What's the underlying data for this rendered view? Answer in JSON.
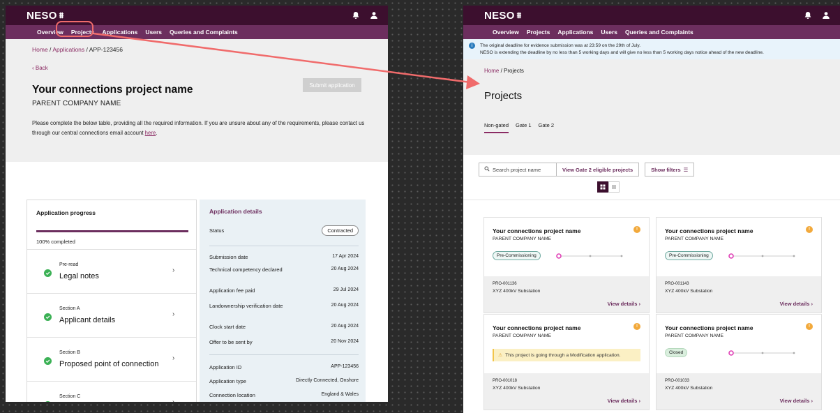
{
  "app": {
    "logo": "NESO",
    "logo_mark": "⩩"
  },
  "nav": [
    "Overview",
    "Projects",
    "Applications",
    "Users",
    "Queries and Complaints"
  ],
  "left": {
    "breadcrumb": {
      "home": "Home",
      "sep": " / ",
      "applications": "Applications",
      "sep2": " / ",
      "current": "APP-123456"
    },
    "back": "‹  Back",
    "title": "Your connections project name",
    "company": "PARENT COMPANY NAME",
    "submit_label": "Submit application",
    "intro_text": "Please complete the below table, providing all the required information. If you are unsure about any of the requirements, please contact us through our central connections email account ",
    "intro_link": "here",
    "intro_end": ".",
    "progress": {
      "title": "Application progress",
      "percent_label": "100% completed",
      "percent": 1.0,
      "sections": [
        {
          "small": "Pre-read",
          "big": "Legal notes"
        },
        {
          "small": "Section A",
          "big": "Applicant details"
        },
        {
          "small": "Section B",
          "big": "Proposed point of connection"
        },
        {
          "small": "Section C",
          "big": ""
        }
      ]
    },
    "details": {
      "title": "Application details",
      "status_label": "Status",
      "status_value": "Contracted",
      "rows": [
        {
          "k": "Submission date",
          "v": "17 Apr 2024"
        },
        {
          "k": "Technical competency declared",
          "v": "20 Aug 2024"
        },
        {
          "k": "Application fee paid",
          "v": "29 Jul 2024"
        },
        {
          "k": "Landownership verification date",
          "v": "20 Aug 2024"
        },
        {
          "k": "Clock start date",
          "v": "20 Aug 2024"
        },
        {
          "k": "Offer to be sent by",
          "v": "20 Nov 2024"
        },
        {
          "k": "Application ID",
          "v": "APP-123456"
        },
        {
          "k": "Application type",
          "v": "Directly Connected, Onshore"
        },
        {
          "k": "Connection location",
          "v": "England & Wales"
        }
      ]
    }
  },
  "right": {
    "banner_line1": "The original deadline for evidence submission was at 23:59 on the 29th of July.",
    "banner_line2": "NESO is extending the deadline by no less than 5 working days and will give no less than 5 working days notice ahead of the new deadline.",
    "breadcrumb": {
      "home": "Home",
      "sep": " / ",
      "current": "Projects"
    },
    "title": "Projects",
    "tabs": [
      "Non-gated",
      "Gate 1",
      "Gate 2"
    ],
    "search_placeholder": "Search project name",
    "gate2_btn": "View Gate 2 eligible projects",
    "filters_btn": "Show filters",
    "cards": [
      {
        "title": "Your connections project name",
        "company": "PARENT COMPANY NAME",
        "stage": "Pre-Commissioning",
        "id": "PRO-001136",
        "sub": "XYZ 400kV Substation",
        "link": "View details  ›"
      },
      {
        "title": "Your connections project name",
        "company": "PARENT COMPANY NAME",
        "stage": "Pre-Commissioning",
        "id": "PRO-001143",
        "sub": "XYZ 400kV Substation",
        "link": "View details  ›"
      },
      {
        "title": "Your connections project name",
        "company": "PARENT COMPANY NAME",
        "note": "This project is going through a Modification application.",
        "id": "PRO-001018",
        "sub": "XYZ 400kV Substation",
        "link": "View details  ›"
      },
      {
        "title": "Your connections project name",
        "company": "PARENT COMPANY NAME",
        "stage": "Closed",
        "id": "PRO-001033",
        "sub": "XYZ 400kV Substation",
        "link": "View details  ›"
      }
    ]
  },
  "colors": {
    "brand_dark": "#3c0f2e",
    "brand": "#6c2e5e",
    "accent": "#8a2b63",
    "success": "#3bb155",
    "warning": "#f2a93b",
    "callout": "#f06b6b"
  },
  "icons": [
    "bell-icon",
    "user-icon",
    "check-icon",
    "chevron-right-icon",
    "info-icon",
    "warning-icon",
    "search-icon",
    "filter-icon",
    "grid-view-icon",
    "list-view-icon"
  ]
}
